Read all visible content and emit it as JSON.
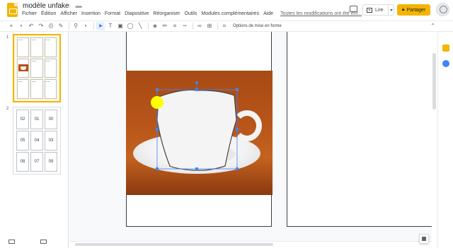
{
  "app": {
    "doc_title": "modèle unfake",
    "menu": [
      "Fichier",
      "Édition",
      "Afficher",
      "Insertion",
      "Format",
      "Diapositive",
      "Réorganiser",
      "Outils",
      "Modules complémentaires",
      "Aide"
    ],
    "save_status": "Toutes les modifications ont été enr...",
    "present_label": "Lire",
    "share_label": "Partager"
  },
  "toolbar": {
    "format_options_label": "Options de mise en forme"
  },
  "filmstrip": {
    "slides": [
      {
        "number": "1"
      },
      {
        "number": "2",
        "cells": [
          "02",
          "01",
          "00",
          "05",
          "04",
          "03",
          "08",
          "07",
          "09"
        ]
      }
    ]
  },
  "colors": {
    "accent": "#f4b400",
    "selection": "#4285f4",
    "marker": "#ffff00"
  },
  "icons": [
    "undo-icon",
    "redo-icon",
    "print-icon",
    "paint-format-icon",
    "zoom-icon",
    "select-icon",
    "textbox-icon",
    "image-icon",
    "shape-icon",
    "line-icon",
    "fill-color-icon",
    "border-color-icon",
    "border-weight-icon",
    "border-dash-icon",
    "link-icon",
    "comment-add-icon",
    "crop-icon",
    "mask-icon"
  ]
}
